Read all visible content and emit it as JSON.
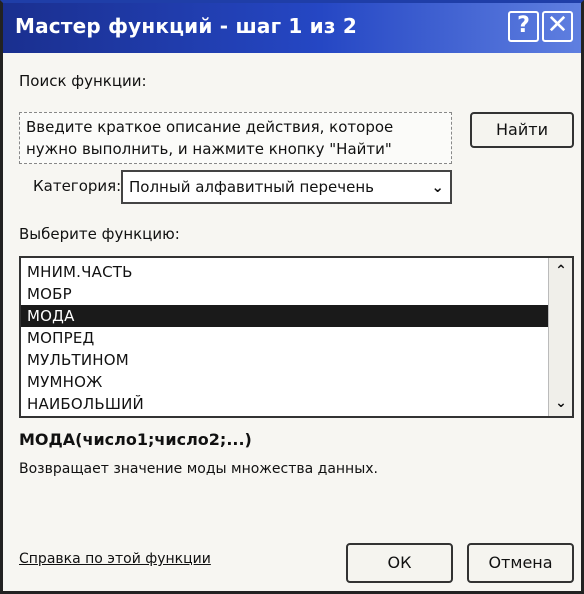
{
  "window": {
    "title": "Мастер функций - шаг 1 из 2",
    "help_glyph": "?",
    "close_glyph": "✕"
  },
  "search": {
    "label": "Поиск функции:",
    "text": "Введите краткое описание действия, которое нужно выполнить, и нажмите кнопку \"Найти\"",
    "find_button": "Найти"
  },
  "category": {
    "label": "Категория:",
    "selected": "Полный алфавитный перечень"
  },
  "function_list": {
    "label": "Выберите функцию:",
    "items": [
      "МНИМ.ЧАСТЬ",
      "МОБР",
      "МОДА",
      "МОПРЕД",
      "МУЛЬТИНОМ",
      "МУМНОЖ",
      "НАИБОЛЬШИЙ"
    ],
    "selected_index": 2
  },
  "details": {
    "signature": "МОДА(число1;число2;...)",
    "description": "Возвращает значение моды множества данных."
  },
  "footer": {
    "help_link": "Справка по этой функции",
    "ok_button": "ОК",
    "cancel_button": "Отмена"
  },
  "colors": {
    "titlebar_start": "#1a2f8f",
    "titlebar_end": "#5f7fe0",
    "selection": "#1a1a1a"
  }
}
